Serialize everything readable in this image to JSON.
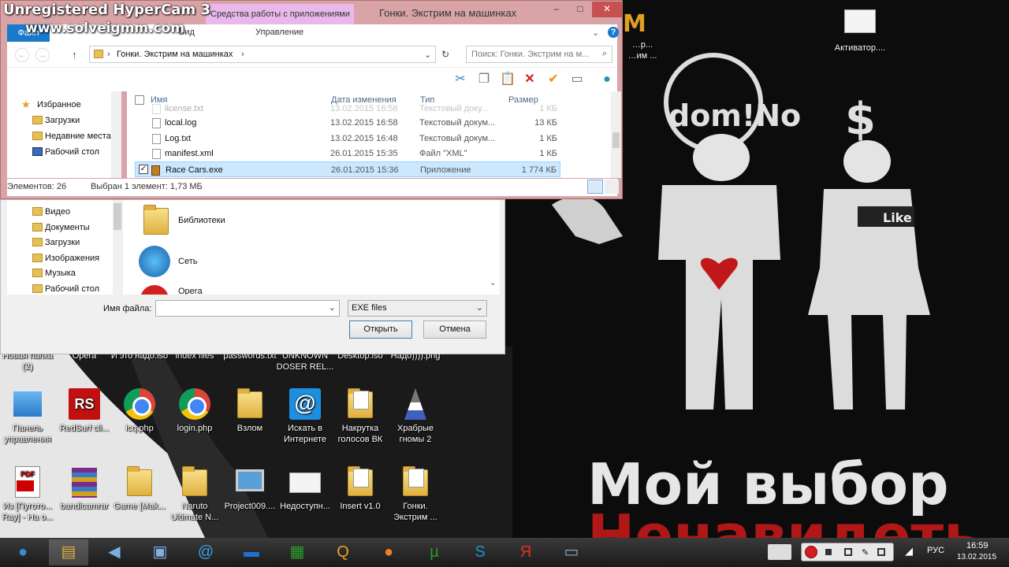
{
  "overlay": {
    "hypercam": "Unregistered HyperCam 3",
    "url": "www.solveigmm.com"
  },
  "wallpaper": {
    "text1": "Мой выбор",
    "text2": "Ненавидеть",
    "logo": "dom!No",
    "dollar": "$",
    "like": "Like",
    "top_logo": "M"
  },
  "explorer": {
    "context_tab": "Средства работы с приложениями",
    "title": "Гонки. Экстрим на машинках",
    "manage_tab": "Управление",
    "file_tab": "Файл",
    "view_tab": "Вид",
    "btn_min": "–",
    "btn_max": "□",
    "btn_close": "✕",
    "address": "Гонки. Экстрим на машинках",
    "search_placeholder": "Поиск: Гонки. Экстрим на м...",
    "nav": [
      {
        "label": "Избранное"
      },
      {
        "label": "Загрузки"
      },
      {
        "label": "Недавние места"
      },
      {
        "label": "Рабочий стол"
      }
    ],
    "columns": {
      "name": "Имя",
      "date": "Дата изменения",
      "type": "Тип",
      "size": "Размер"
    },
    "files": [
      {
        "name": "license.txt",
        "date": "13.02.2015 16:58",
        "type": "Текстовый доку...",
        "size": "1 КБ"
      },
      {
        "name": "local.log",
        "date": "13.02.2015 16:58",
        "type": "Текстовый докум...",
        "size": "13 КБ"
      },
      {
        "name": "Log.txt",
        "date": "13.02.2015 16:48",
        "type": "Текстовый докум...",
        "size": "1 КБ"
      },
      {
        "name": "manifest.xml",
        "date": "26.01.2015 15:35",
        "type": "Файл \"XML\"",
        "size": "1 КБ"
      },
      {
        "name": "Race Cars.exe",
        "date": "26.01.2015 15:36",
        "type": "Приложение",
        "size": "1 774 КБ"
      }
    ],
    "status_count": "Элементов: 26",
    "status_selected": "Выбран 1 элемент: 1,73 МБ"
  },
  "dialog": {
    "nav": [
      {
        "label": "Видео"
      },
      {
        "label": "Документы"
      },
      {
        "label": "Загрузки"
      },
      {
        "label": "Изображения"
      },
      {
        "label": "Музыка"
      },
      {
        "label": "Рабочий стол"
      }
    ],
    "items": [
      {
        "label": "Библиотеки"
      },
      {
        "label": "Сеть"
      },
      {
        "label": "Opera"
      }
    ],
    "filename_label": "Имя файла:",
    "filename_value": "",
    "filter": "EXE files",
    "open": "Открыть",
    "cancel": "Отмена"
  },
  "desktop": {
    "row0": [
      "Новая папка (2)",
      "Opera",
      "И это надо.iso",
      "index files",
      "passwords.txt",
      "UNKNOWN DOSER REL...",
      "Desktop.iso",
      "Надо)))).png"
    ],
    "row1": [
      "Панель управления",
      "RedSurf cli...",
      "icq.php",
      "login.php",
      "Взлом",
      "Искать в Интернете",
      "Накрутка голосов ВК",
      "Храбрые гномы 2"
    ],
    "row2": [
      "Из [Пугото... Ray] - На о...",
      "bandicamrar",
      "Game [Mak...",
      "Naruto Ultimate N...",
      "Project009....",
      "Недоступн...",
      "Insert v1.0",
      "Гонки. Экстрим ..."
    ],
    "top_right": [
      "…M",
      "Активатор...."
    ],
    "top_mid": [
      "…р...",
      "…им ..."
    ]
  },
  "taskbar": {
    "lang": "РУС",
    "time": "16:59",
    "date": "13.02.2015",
    "icons": [
      "start-orb-icon",
      "file-explorer-icon",
      "speaker-app-icon",
      "screen-app-icon",
      "icq-app-icon",
      "lenovo-app-icon",
      "store-app-icon",
      "search-app-icon",
      "firefox-icon",
      "utorrent-icon",
      "skype-icon",
      "yandex-icon",
      "activator-app-icon"
    ]
  }
}
